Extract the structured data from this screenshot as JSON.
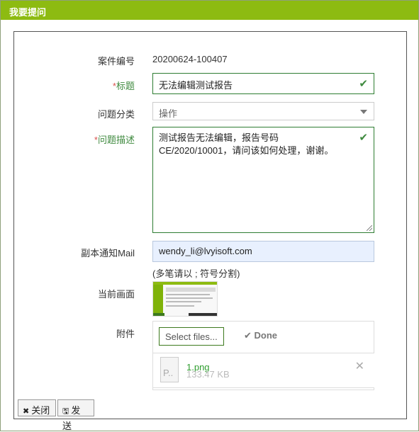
{
  "window": {
    "title": "我要提问"
  },
  "form": {
    "case_no": {
      "label": "案件编号",
      "value": "20200624-100407"
    },
    "title": {
      "required_mark": "*",
      "label": "标题",
      "value": "无法编辑测试报告"
    },
    "category": {
      "label": "问题分类",
      "selected": "操作"
    },
    "description": {
      "required_mark": "*",
      "label": "问题描述",
      "lines": [
        "测试报告无法编辑，报告号码",
        "CE/2020/10001，请问该如何处理，谢谢。"
      ]
    },
    "cc_mail": {
      "label": "副本通知Mail",
      "value": "wendy_li@lvyisoft.com",
      "hint": "(多笔请以 ; 符号分割)"
    },
    "screenshot": {
      "label": "当前画面"
    },
    "attachment": {
      "label": "附件",
      "select_files": "Select files...",
      "status": "Done",
      "files": [
        {
          "name": "1.png",
          "size": "133.47 KB",
          "icon_text": "P.."
        }
      ]
    }
  },
  "footer": {
    "close_label": "关闭",
    "send_label": "发送"
  },
  "colors": {
    "titlebar": "#8dbb11",
    "required": "#3f8a3f",
    "star": "#d9534f",
    "link": "#2e9d2e"
  }
}
